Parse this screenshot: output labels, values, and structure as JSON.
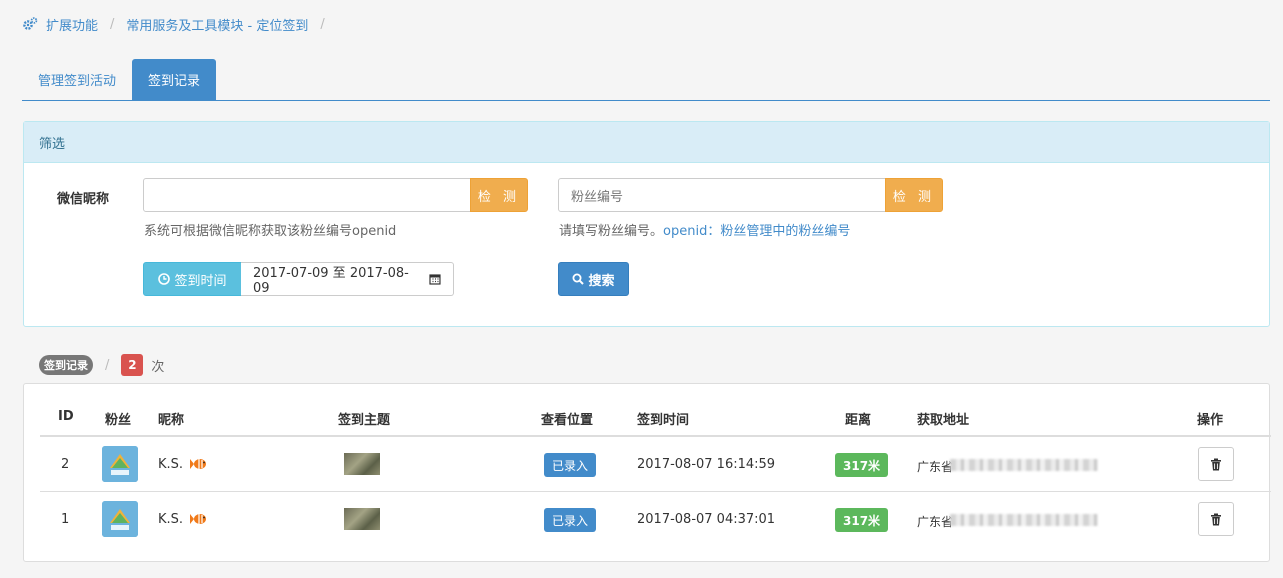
{
  "breadcrumb": {
    "icon": "gears-icon",
    "items": [
      "扩展功能",
      "常用服务及工具模块 - 定位签到"
    ],
    "separator": "/"
  },
  "tabs": [
    {
      "label": "管理签到活动",
      "active": false
    },
    {
      "label": "签到记录",
      "active": true
    }
  ],
  "filter": {
    "title": "筛选",
    "nickname_label": "微信昵称",
    "nickname_value": "",
    "nickname_check": "检 测",
    "nickname_help": "系统可根据微信昵称获取该粉丝编号openid",
    "fan_placeholder": "粉丝编号",
    "fan_check": "检 测",
    "fan_help_prefix": "请填写粉丝编号。",
    "fan_help_link": "openid：粉丝管理中的粉丝编号",
    "date_button": "签到时间",
    "date_range": "2017-07-09 至 2017-08-09",
    "search_button": "搜索"
  },
  "summary": {
    "label": "签到记录",
    "separator": "/",
    "count": "2",
    "unit": "次"
  },
  "table": {
    "headers": [
      "ID",
      "粉丝",
      "昵称",
      "签到主题",
      "查看位置",
      "签到时间",
      "距离",
      "获取地址",
      "操作"
    ],
    "rows": [
      {
        "id": "2",
        "nickname": "K.S.",
        "location": "已录入",
        "time": "2017-08-07 16:14:59",
        "distance": "317米",
        "address": "广东省"
      },
      {
        "id": "1",
        "nickname": "K.S.",
        "location": "已录入",
        "time": "2017-08-07 04:37:01",
        "distance": "317米",
        "address": "广东省"
      }
    ]
  },
  "colors": {
    "primary": "#428bca",
    "warning": "#f0ad4e",
    "info": "#5bc0de",
    "danger": "#d9534f",
    "success": "#5cb85c"
  }
}
